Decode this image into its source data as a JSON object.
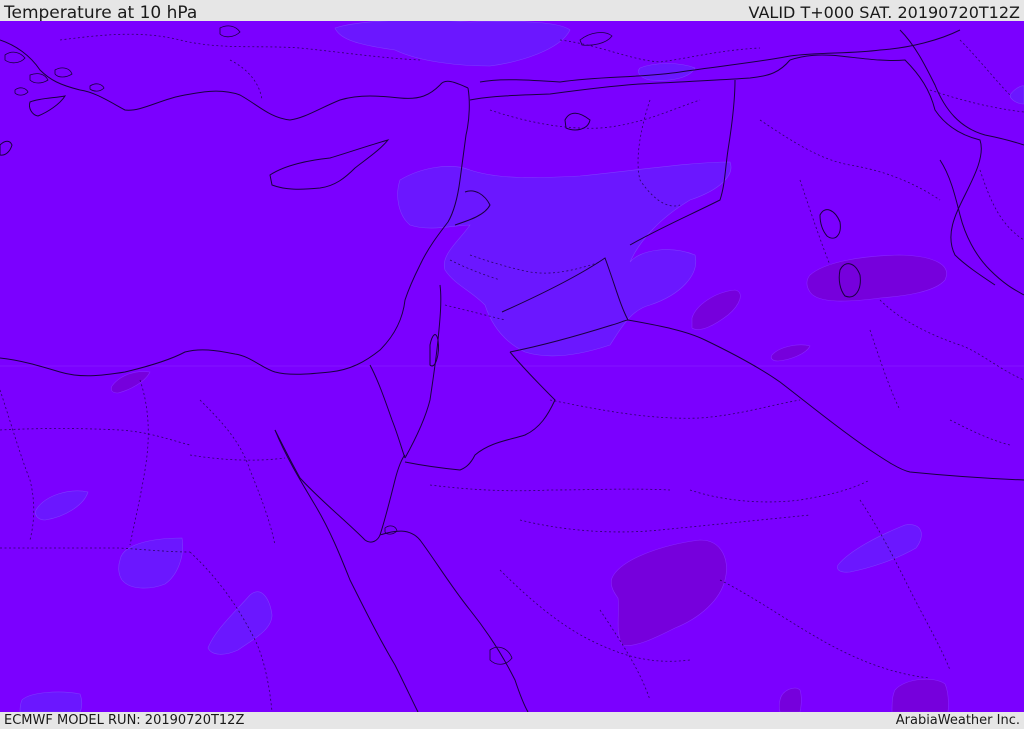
{
  "header": {
    "title": "Temperature at 10 hPa",
    "valid": "VALID T+000 SAT. 20190720T12Z"
  },
  "footer": {
    "model_run": "ECMWF MODEL RUN: 20190720T12Z",
    "credit": "ArabiaWeather Inc."
  },
  "map": {
    "field_colors": {
      "base": "#7b00ff",
      "cool": "#6a15ff",
      "warm": "#7a00e6"
    }
  }
}
